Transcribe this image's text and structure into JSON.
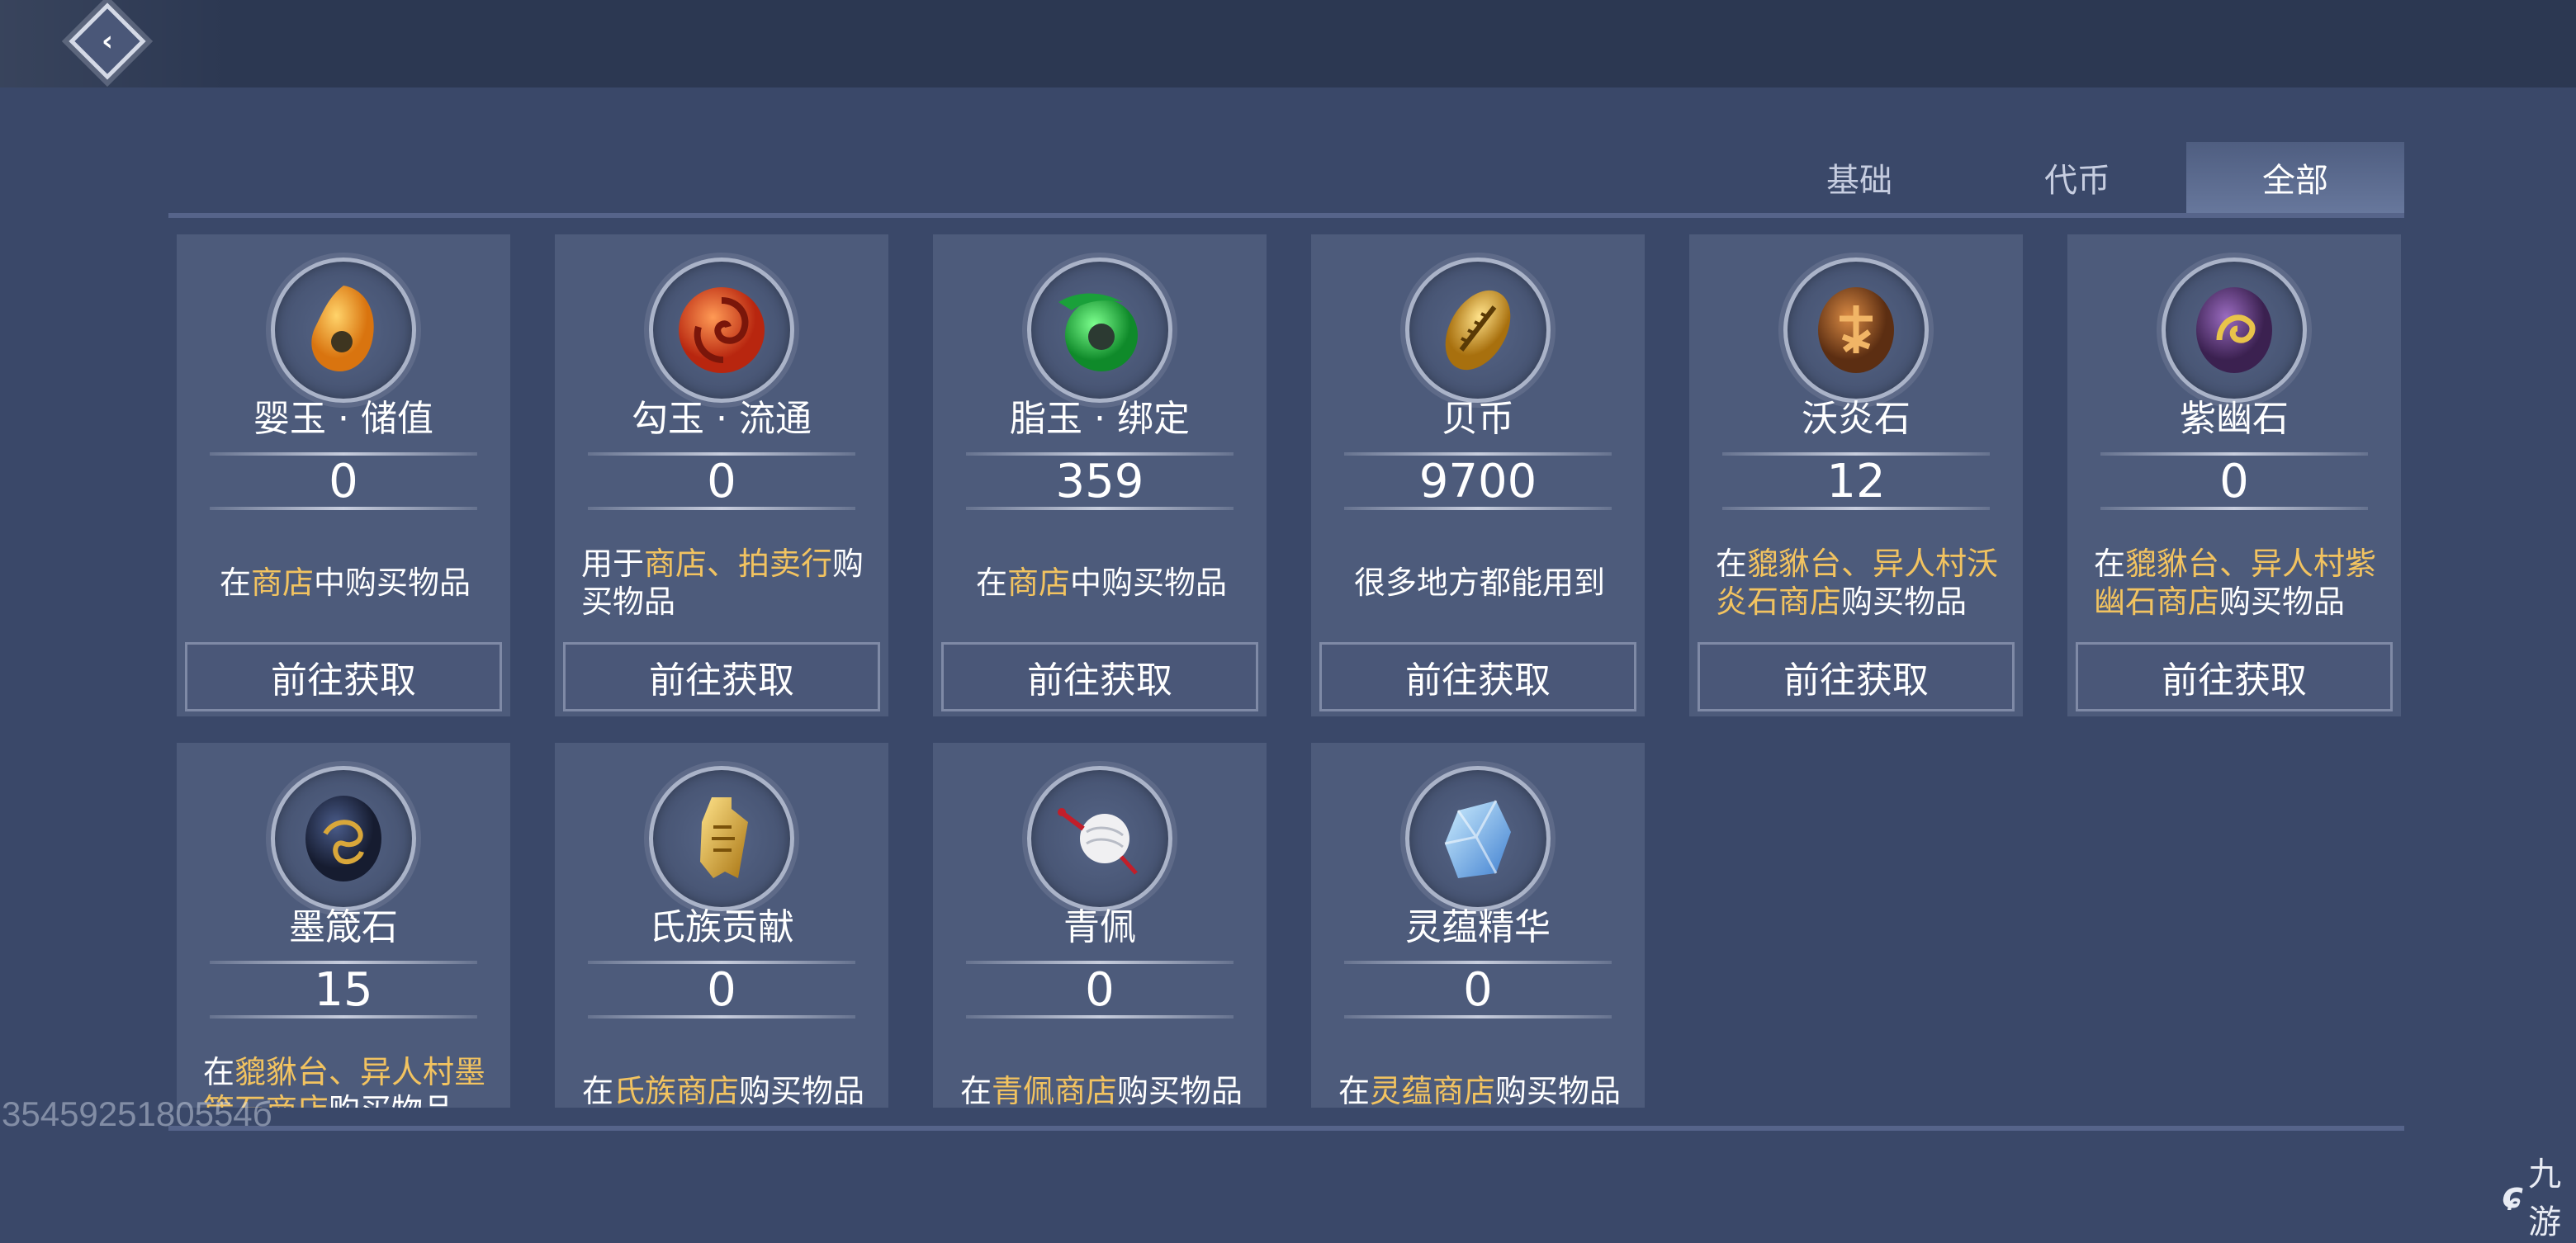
{
  "tabs": [
    {
      "label": "基础",
      "active": false
    },
    {
      "label": "代币",
      "active": false
    },
    {
      "label": "全部",
      "active": true
    }
  ],
  "get_button_label": "前往获取",
  "items": [
    {
      "name": "婴玉 · 储值",
      "count": "0",
      "icon": "orange-jade-pendant-icon",
      "desc": [
        {
          "t": "在"
        },
        {
          "t": "商店",
          "hl": true
        },
        {
          "t": "中购买物品"
        }
      ],
      "has_button": true
    },
    {
      "name": "勾玉 · 流通",
      "count": "0",
      "icon": "red-magatama-icon",
      "desc": [
        {
          "t": "用于"
        },
        {
          "t": "商店、拍卖行",
          "hl": true
        },
        {
          "t": "购买物品"
        }
      ],
      "has_button": true
    },
    {
      "name": "脂玉 · 绑定",
      "count": "359",
      "icon": "green-jade-icon",
      "desc": [
        {
          "t": "在"
        },
        {
          "t": "商店",
          "hl": true
        },
        {
          "t": "中购买物品"
        }
      ],
      "has_button": true
    },
    {
      "name": "贝币",
      "count": "9700",
      "icon": "golden-shell-coin-icon",
      "desc": [
        {
          "t": "很多地方都能用到"
        }
      ],
      "has_button": true
    },
    {
      "name": "沃炎石",
      "count": "12",
      "icon": "bronze-rune-stone-icon",
      "desc": [
        {
          "t": "在"
        },
        {
          "t": "貔貅台、异人村沃炎石商店",
          "hl": true
        },
        {
          "t": "购买物品"
        }
      ],
      "has_button": true
    },
    {
      "name": "紫幽石",
      "count": "0",
      "icon": "purple-rune-stone-icon",
      "desc": [
        {
          "t": "在"
        },
        {
          "t": "貔貅台、异人村紫幽石商店",
          "hl": true
        },
        {
          "t": "购买物品"
        }
      ],
      "has_button": true
    },
    {
      "name": "墨箴石",
      "count": "15",
      "icon": "dark-dragon-stone-icon",
      "desc": [
        {
          "t": "在"
        },
        {
          "t": "貔貅台、异人村墨箴石商店",
          "hl": true
        },
        {
          "t": "购买物品"
        }
      ],
      "has_button": true
    },
    {
      "name": "氏族贡献",
      "count": "0",
      "icon": "golden-bell-token-icon",
      "desc": [
        {
          "t": "在"
        },
        {
          "t": "氏族商店",
          "hl": true
        },
        {
          "t": "购买物品"
        }
      ],
      "has_button": true
    },
    {
      "name": "青佩",
      "count": "0",
      "icon": "white-tassel-pendant-icon",
      "desc": [
        {
          "t": "在"
        },
        {
          "t": "青佩商店",
          "hl": true
        },
        {
          "t": "购买物品"
        }
      ],
      "has_button": true
    },
    {
      "name": "灵蕴精华",
      "count": "0",
      "icon": "blue-crystal-icon",
      "desc": [
        {
          "t": "在"
        },
        {
          "t": "灵蕴商店",
          "hl": true
        },
        {
          "t": "购买物品"
        }
      ],
      "has_button": true
    }
  ],
  "watermark_id": "3545925180554б",
  "site_logo_text": "九游"
}
